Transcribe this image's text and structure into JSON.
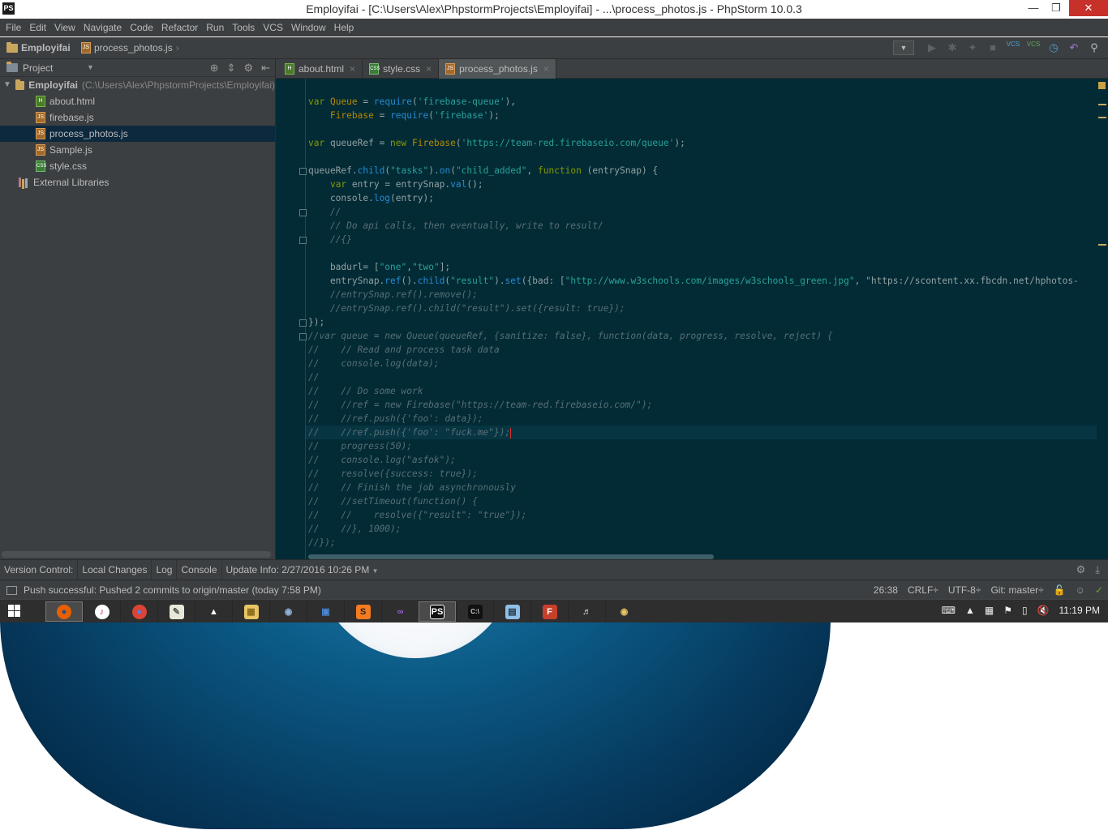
{
  "window": {
    "app_icon": "PS",
    "title": "Employifai - [C:\\Users\\Alex\\PhpstormProjects\\Employifai] - ...\\process_photos.js - PhpStorm 10.0.3",
    "controls": [
      "minimize",
      "maximize",
      "close"
    ]
  },
  "menu": [
    "File",
    "Edit",
    "View",
    "Navigate",
    "Code",
    "Refactor",
    "Run",
    "Tools",
    "VCS",
    "Window",
    "Help"
  ],
  "navbar": {
    "project": "Employifai",
    "file": "process_photos.js",
    "toolbar_icons": [
      "run-config-dropdown",
      "run-icon",
      "debug-icon",
      "coverage-icon",
      "stop-icon",
      "vcs-update-icon",
      "vcs-commit-icon",
      "history-icon",
      "revert-icon",
      "search-everywhere-icon"
    ],
    "vcs_label": "VCS"
  },
  "project_panel": {
    "title": "Project",
    "root": {
      "name": "Employifai",
      "path": "(C:\\Users\\Alex\\PhpstormProjects\\Employifai)"
    },
    "files": [
      {
        "name": "about.html",
        "icon": "html-file-icon",
        "selected": false
      },
      {
        "name": "firebase.js",
        "icon": "js-file-icon",
        "selected": false
      },
      {
        "name": "process_photos.js",
        "icon": "js-file-icon",
        "selected": true
      },
      {
        "name": "Sample.js",
        "icon": "js-file-icon",
        "selected": false
      },
      {
        "name": "style.css",
        "icon": "css-file-icon",
        "selected": false
      }
    ],
    "external": "External Libraries"
  },
  "tabs": [
    {
      "label": "about.html",
      "icon": "html-file-icon",
      "active": false
    },
    {
      "label": "style.css",
      "icon": "css-file-icon",
      "active": false
    },
    {
      "label": "process_photos.js",
      "icon": "js-file-icon",
      "active": true
    }
  ],
  "code_lines": [
    "var Queue = require('firebase-queue'),",
    "    Firebase = require('firebase');",
    "",
    "var queueRef = new Firebase('https://team-red.firebaseio.com/queue');",
    "",
    "queueRef.child(\"tasks\").on(\"child_added\", function (entrySnap) {",
    "    var entry = entrySnap.val();",
    "    console.log(entry);",
    "    //",
    "    // Do api calls, then eventually, write to result/",
    "    //{}",
    "",
    "    badurl= [\"one\",\"two\"];",
    "    entrySnap.ref().child(\"result\").set({bad: [\"http://www.w3schools.com/images/w3schools_green.jpg\", \"https://scontent.xx.fbcdn.net/hphotos-",
    "    //entrySnap.ref().remove();",
    "    //entrySnap.ref().child(\"result\").set({result: true});",
    "});",
    "//var queue = new Queue(queueRef, {sanitize: false}, function(data, progress, resolve, reject) {",
    "//    // Read and process task data",
    "//    console.log(data);",
    "//",
    "//    // Do some work",
    "//    //ref = new Firebase(\"https://team-red.firebaseio.com/\");",
    "//    //ref.push({'foo': data});",
    "//    //ref.push({'foo': \"fuck.me\"});",
    "//    progress(50);",
    "//    console.log(\"asfok\");",
    "//    resolve({success: true});",
    "//    // Finish the job asynchronously",
    "//    //setTimeout(function() {",
    "//    //    resolve({\"result\": \"true\"});",
    "//    //}, 1000);",
    "//});"
  ],
  "bottom_tools": [
    "Version Control:",
    "Local Changes",
    "Log",
    "Console",
    "Update Info: 2/27/2016 10:26 PM"
  ],
  "status": {
    "message": "Push successful: Pushed 2 commits to origin/master (today 7:58 PM)",
    "position": "26:38",
    "line_sep": "CRLF÷",
    "encoding": "UTF-8÷",
    "git": "Git: master÷"
  },
  "taskbar": {
    "apps": [
      "firefox-icon",
      "itunes-icon",
      "chrome-icon",
      "notepad-icon",
      "inkscape-icon",
      "file-explorer-icon",
      "paint-icon",
      "remote-desktop-icon",
      "sublime-icon",
      "visual-studio-icon",
      "phpstorm-icon",
      "cmd-icon",
      "notepad2-icon",
      "filezilla-icon",
      "audio-icon",
      "paint2-icon"
    ],
    "clock": "11:19 PM"
  },
  "colors": {
    "editor_bg": "#022b36",
    "panel_bg": "#3c3f41",
    "keyword": "#859900",
    "string": "#2aa198",
    "comment": "#586e75",
    "accent_close": "#c7312a"
  }
}
